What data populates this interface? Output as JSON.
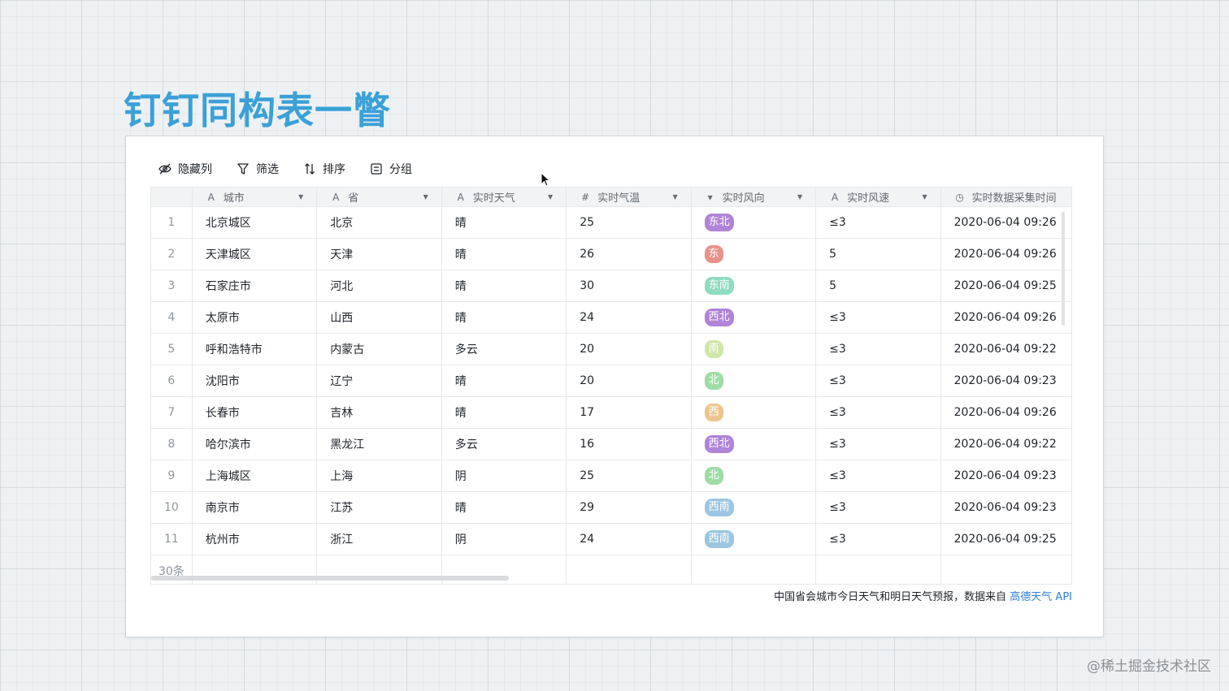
{
  "title": "钉钉同构表一瞥",
  "toolbar": {
    "hide_columns": "隐藏列",
    "filter": "筛选",
    "sort": "排序",
    "group": "分组"
  },
  "columns": [
    {
      "label": "城市",
      "type_icon": "A"
    },
    {
      "label": "省",
      "type_icon": "A"
    },
    {
      "label": "实时天气",
      "type_icon": "A"
    },
    {
      "label": "实时气温",
      "type_icon": "#"
    },
    {
      "label": "实时风向",
      "type_icon": "▾"
    },
    {
      "label": "实时风速",
      "type_icon": "A"
    },
    {
      "label": "实时数据采集时间",
      "type_icon": "◷"
    }
  ],
  "rows": [
    {
      "idx": "1",
      "city": "北京城区",
      "province": "北京",
      "weather": "晴",
      "temp": "25",
      "wind_dir": "东北",
      "wind_color": "#b084d8",
      "wind_speed": "≤3",
      "time": "2020-06-04 09:26"
    },
    {
      "idx": "2",
      "city": "天津城区",
      "province": "天津",
      "weather": "晴",
      "temp": "26",
      "wind_dir": "东",
      "wind_color": "#e8928a",
      "wind_speed": "5",
      "time": "2020-06-04 09:26"
    },
    {
      "idx": "3",
      "city": "石家庄市",
      "province": "河北",
      "weather": "晴",
      "temp": "30",
      "wind_dir": "东南",
      "wind_color": "#8fdcc0",
      "wind_speed": "5",
      "time": "2020-06-04 09:25"
    },
    {
      "idx": "4",
      "city": "太原市",
      "province": "山西",
      "weather": "晴",
      "temp": "24",
      "wind_dir": "西北",
      "wind_color": "#b084d8",
      "wind_speed": "≤3",
      "time": "2020-06-04 09:26"
    },
    {
      "idx": "5",
      "city": "呼和浩特市",
      "province": "内蒙古",
      "weather": "多云",
      "temp": "20",
      "wind_dir": "南",
      "wind_color": "#cfe6a8",
      "wind_speed": "≤3",
      "time": "2020-06-04 09:22"
    },
    {
      "idx": "6",
      "city": "沈阳市",
      "province": "辽宁",
      "weather": "晴",
      "temp": "20",
      "wind_dir": "北",
      "wind_color": "#9edca4",
      "wind_speed": "≤3",
      "time": "2020-06-04 09:23"
    },
    {
      "idx": "7",
      "city": "长春市",
      "province": "吉林",
      "weather": "晴",
      "temp": "17",
      "wind_dir": "西",
      "wind_color": "#ecc58e",
      "wind_speed": "≤3",
      "time": "2020-06-04 09:26"
    },
    {
      "idx": "8",
      "city": "哈尔滨市",
      "province": "黑龙江",
      "weather": "多云",
      "temp": "16",
      "wind_dir": "西北",
      "wind_color": "#b084d8",
      "wind_speed": "≤3",
      "time": "2020-06-04 09:22"
    },
    {
      "idx": "9",
      "city": "上海城区",
      "province": "上海",
      "weather": "阴",
      "temp": "25",
      "wind_dir": "北",
      "wind_color": "#9edca4",
      "wind_speed": "≤3",
      "time": "2020-06-04 09:23"
    },
    {
      "idx": "10",
      "city": "南京市",
      "province": "江苏",
      "weather": "晴",
      "temp": "29",
      "wind_dir": "西南",
      "wind_color": "#9cc6e0",
      "wind_speed": "≤3",
      "time": "2020-06-04 09:23"
    },
    {
      "idx": "11",
      "city": "杭州市",
      "province": "浙江",
      "weather": "阴",
      "temp": "24",
      "wind_dir": "西南",
      "wind_color": "#9cc6e0",
      "wind_speed": "≤3",
      "time": "2020-06-04 09:25"
    }
  ],
  "footer": {
    "count": "30条"
  },
  "note": {
    "text": "中国省会城市今日天气和明日天气预报，数据来自",
    "link": "高德天气 API"
  },
  "watermark": "@稀土掘金技术社区"
}
